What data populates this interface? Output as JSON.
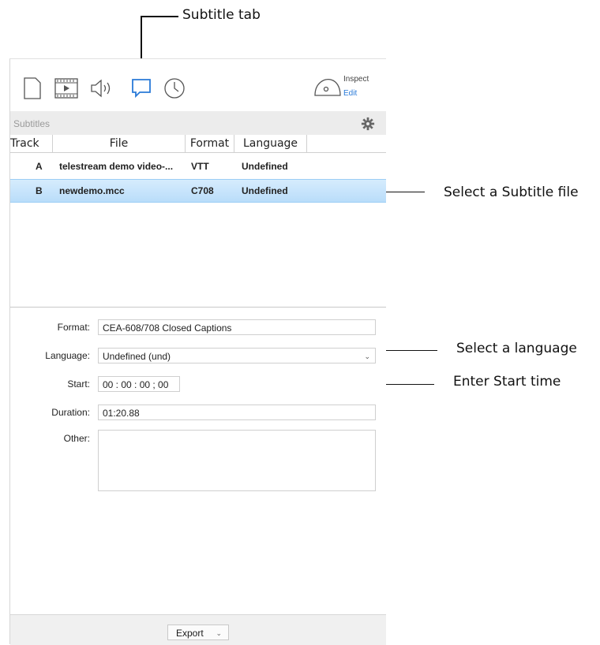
{
  "callouts": {
    "subtitle_tab": "Subtitle tab",
    "select_file": "Select a Subtitle file",
    "select_language": "Select a language",
    "enter_start": "Enter Start time"
  },
  "toolbar": {
    "icons": [
      "document-icon",
      "video-icon",
      "audio-icon",
      "subtitle-icon",
      "clock-icon"
    ],
    "active_tab": "subtitle-icon",
    "inspect_label": "Inspect",
    "edit_label": "Edit",
    "accent_color": "#2a7ad8"
  },
  "subtitles": {
    "section_title": "Subtitles",
    "columns": [
      "Track",
      "File",
      "Format",
      "Language"
    ],
    "rows": [
      {
        "track": "A",
        "file": "telestream demo video-...",
        "format": "VTT",
        "language": "Undefined"
      },
      {
        "track": "B",
        "file": "newdemo.mcc",
        "format": "C708",
        "language": "Undefined"
      }
    ],
    "selected_row": "B"
  },
  "details": {
    "format_label": "Format:",
    "format_value": "CEA-608/708 Closed Captions",
    "language_label": "Language:",
    "language_value": "Undefined (und)",
    "start_label": "Start:",
    "start_value": "00 : 00 : 00 ; 00",
    "duration_label": "Duration:",
    "duration_value": "01:20.88",
    "other_label": "Other:",
    "other_value": ""
  },
  "footer": {
    "export_label": "Export"
  }
}
